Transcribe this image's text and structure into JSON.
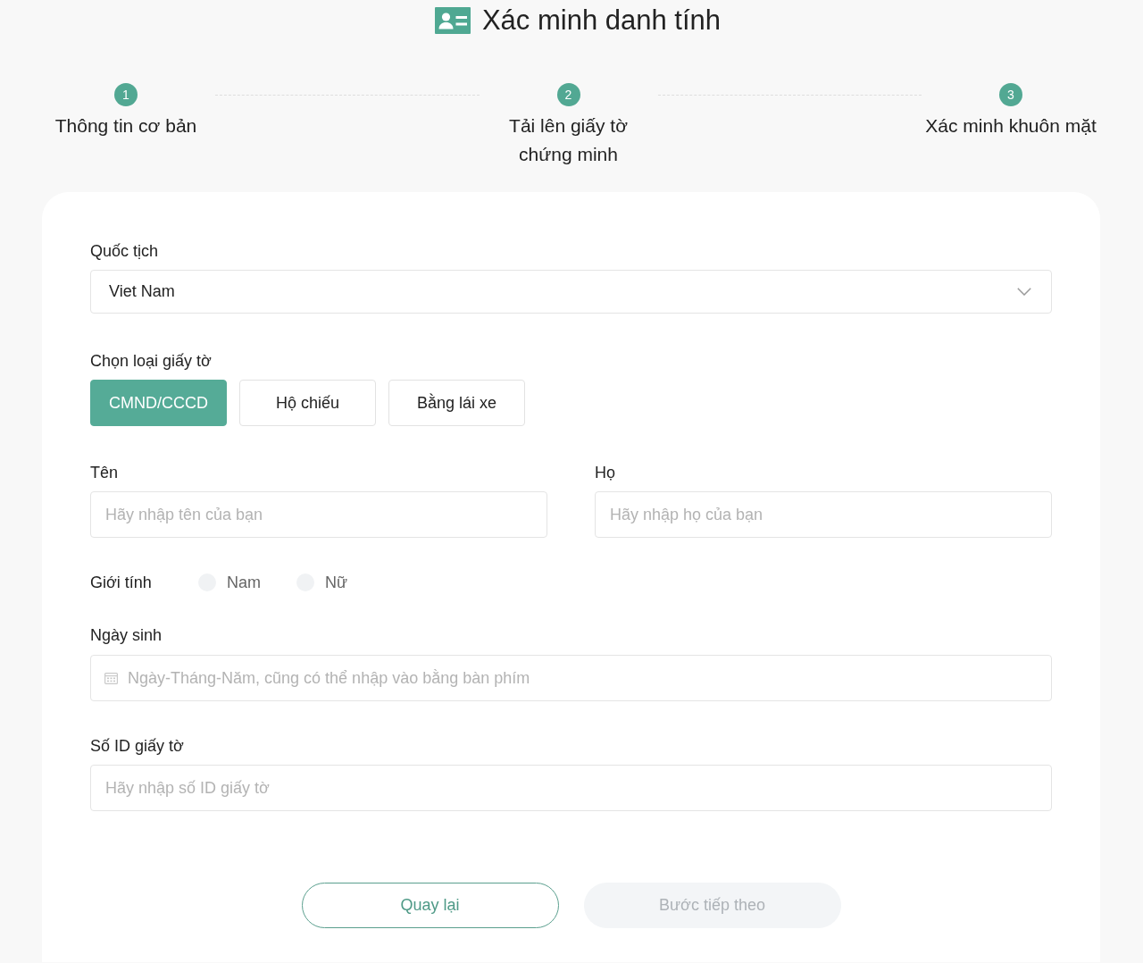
{
  "header": {
    "title": "Xác minh danh tính"
  },
  "steps": [
    {
      "number": "1",
      "label": "Thông tin cơ bản"
    },
    {
      "number": "2",
      "label": "Tải lên giấy tờ chứng minh"
    },
    {
      "number": "3",
      "label": "Xác minh khuôn mặt"
    }
  ],
  "form": {
    "nationality": {
      "label": "Quốc tịch",
      "value": "Viet Nam"
    },
    "document_type": {
      "label": "Chọn loại giấy tờ",
      "options": [
        {
          "label": "CMND/CCCD",
          "selected": true
        },
        {
          "label": "Hộ chiếu",
          "selected": false
        },
        {
          "label": "Bằng lái xe",
          "selected": false
        }
      ]
    },
    "first_name": {
      "label": "Tên",
      "placeholder": "Hãy nhập tên của bạn"
    },
    "last_name": {
      "label": "Họ",
      "placeholder": "Hãy nhập họ của bạn"
    },
    "gender": {
      "label": "Giới tính",
      "options": [
        {
          "label": "Nam",
          "selected": false
        },
        {
          "label": "Nữ",
          "selected": false
        }
      ]
    },
    "birth_date": {
      "label": "Ngày sinh",
      "placeholder": "Ngày-Tháng-Năm, cũng có thể nhập vào bằng bàn phím"
    },
    "id_number": {
      "label": "Số ID giấy tờ",
      "placeholder": "Hãy nhập số ID giấy tờ"
    }
  },
  "actions": [
    {
      "label": "Quay lại",
      "kind": "outline",
      "disabled": false
    },
    {
      "label": "Bước tiếp theo",
      "kind": "primary",
      "disabled": true
    }
  ]
}
